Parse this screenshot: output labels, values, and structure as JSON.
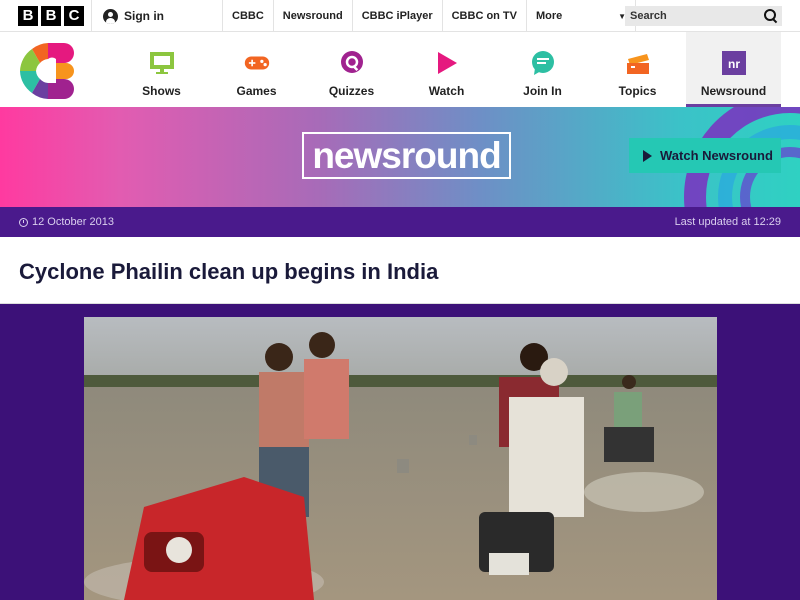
{
  "bbc_bar": {
    "logo_letters": [
      "B",
      "B",
      "C"
    ],
    "sign_in": "Sign in",
    "nav": [
      "CBBC",
      "Newsround",
      "CBBC iPlayer",
      "CBBC on TV"
    ],
    "more": "More",
    "search_placeholder": "Search"
  },
  "cbbc_nav": {
    "items": [
      {
        "label": "Shows",
        "icon": "tv-icon",
        "color": "#8cc63f"
      },
      {
        "label": "Games",
        "icon": "gamepad-icon",
        "color": "#f26522"
      },
      {
        "label": "Quizzes",
        "icon": "quiz-icon",
        "color": "#a0228f"
      },
      {
        "label": "Watch",
        "icon": "play-icon",
        "color": "#e5197f"
      },
      {
        "label": "Join In",
        "icon": "chat-icon",
        "color": "#2dbfa3"
      },
      {
        "label": "Topics",
        "icon": "topics-icon",
        "color": "#f26522"
      },
      {
        "label": "Newsround",
        "icon": "newsround-icon",
        "color": "#6b3fa0"
      }
    ],
    "active": "Newsround"
  },
  "hero": {
    "title": "newsround",
    "watch_button": "Watch Newsround"
  },
  "article": {
    "date": "12 October 2013",
    "last_updated": "Last updated at 12:29",
    "headline": "Cyclone Phailin clean up begins in India"
  },
  "colors": {
    "purple_dark": "#4a1a8c",
    "purple_bg": "#3c1178",
    "teal_button": "#25c8b4",
    "headline_text": "#1a1a3a"
  }
}
